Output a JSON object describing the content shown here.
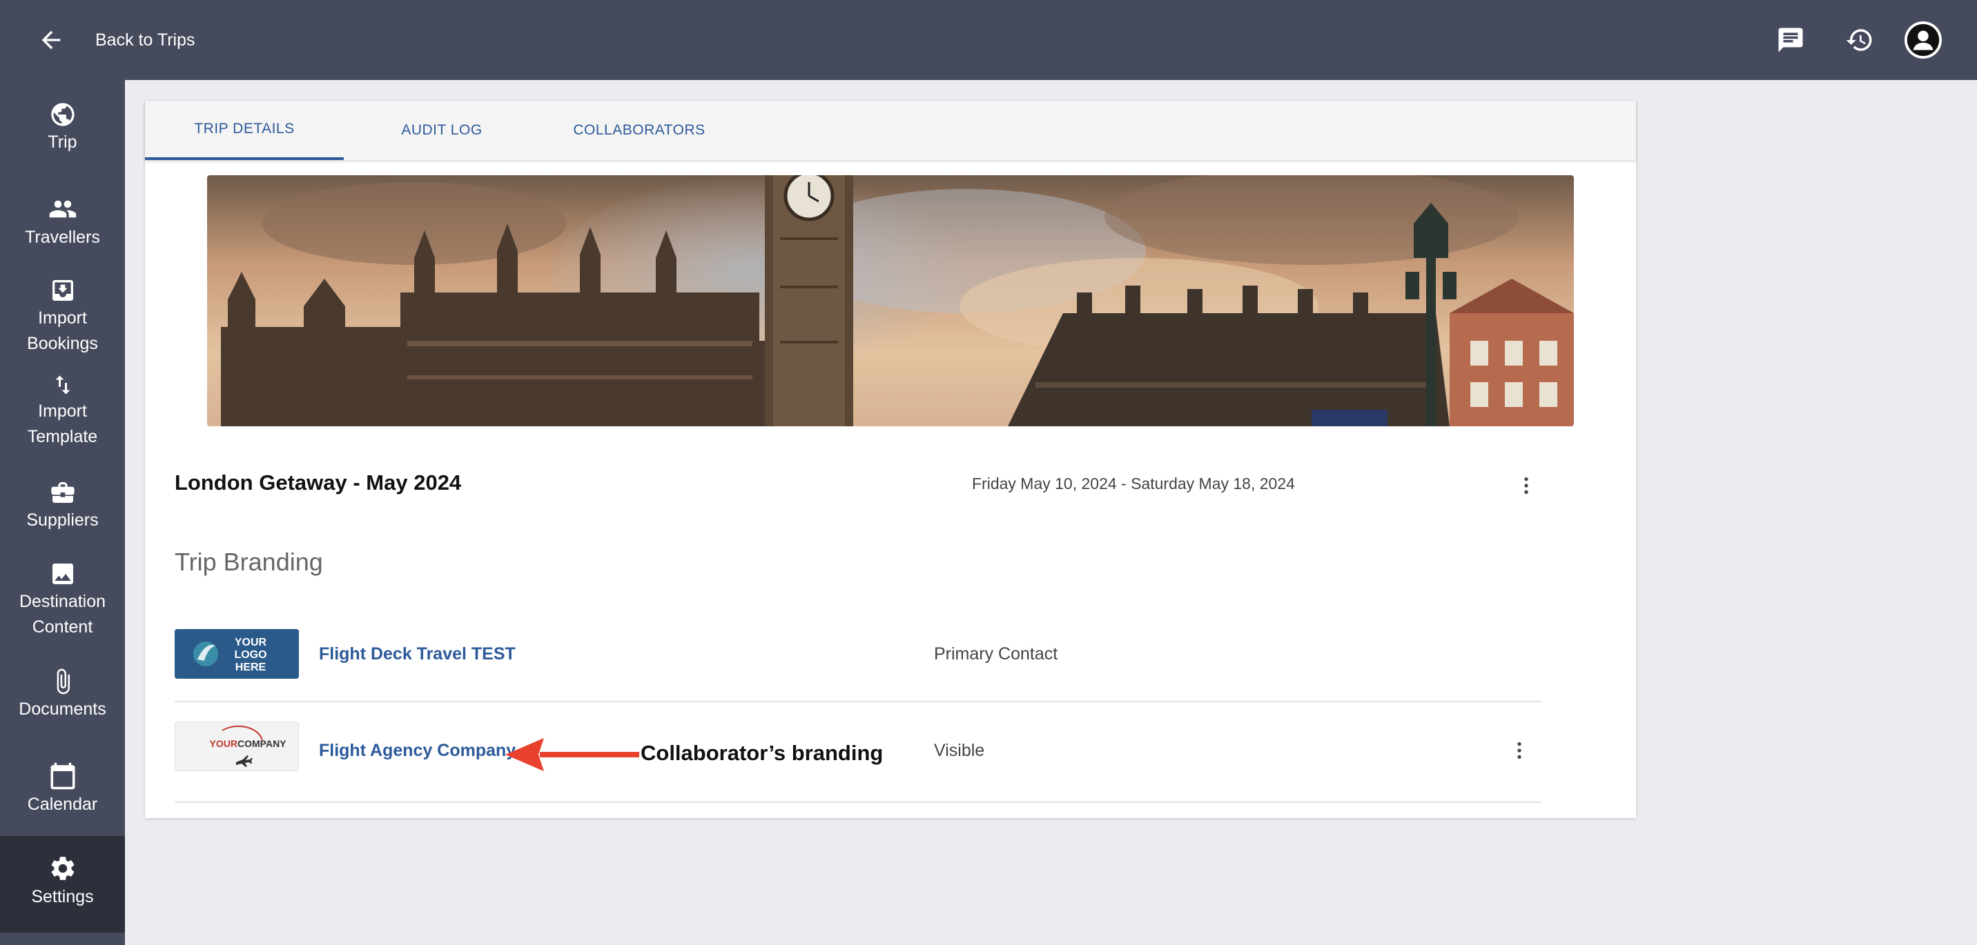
{
  "header": {
    "back_label": "Back to Trips",
    "icons": [
      "chat-icon",
      "history-icon",
      "account-icon"
    ]
  },
  "sidebar": {
    "items": [
      {
        "label": "Trip",
        "icon": "globe-icon"
      },
      {
        "label": "Travellers",
        "icon": "people-icon"
      },
      {
        "label": "Import Bookings",
        "icon": "import-icon"
      },
      {
        "label": "Import Template",
        "icon": "swap-icon"
      },
      {
        "label": "Suppliers",
        "icon": "briefcase-icon"
      },
      {
        "label": "Destination Content",
        "icon": "image-icon"
      },
      {
        "label": "Documents",
        "icon": "paperclip-icon"
      },
      {
        "label": "Calendar",
        "icon": "calendar-icon"
      },
      {
        "label": "Settings",
        "icon": "gear-icon",
        "active": true
      }
    ]
  },
  "tabs": [
    {
      "label": "TRIP DETAILS",
      "active": true
    },
    {
      "label": "AUDIT LOG",
      "active": false
    },
    {
      "label": "COLLABORATORS",
      "active": false
    }
  ],
  "trip": {
    "title": "London Getaway - May 2024",
    "dates": "Friday May 10, 2024 - Saturday May 18, 2024"
  },
  "branding": {
    "title": "Trip Branding",
    "rows": [
      {
        "logo_text": [
          "YOUR",
          "LOGO",
          "HERE"
        ],
        "name": "Flight Deck Travel TEST",
        "status": "Primary Contact"
      },
      {
        "logo_text": [
          "YOUR",
          "COMPANY"
        ],
        "name": "Flight Agency Company",
        "status": "Visible"
      }
    ]
  },
  "annotation": {
    "label": "Collaborator’s branding",
    "arrow_color": "#e8412c"
  },
  "colors": {
    "chrome": "#454b5c",
    "active_nav": "#2c303b",
    "accent": "#2d5a9a",
    "page_bg": "#ebecf0"
  }
}
